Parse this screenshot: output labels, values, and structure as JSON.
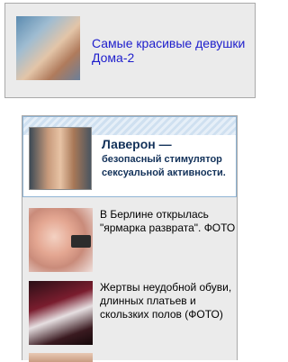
{
  "top_block": {
    "link_text": "Самые красивые девушки Дома-2"
  },
  "featured": {
    "title": "Лаверон —",
    "text": "безопасный стимулятор сексуальной активности."
  },
  "news": [
    {
      "text": "В Берлине открылась \"ярмарка разврата\". ФОТО"
    },
    {
      "text": "Жертвы неудобной обуви, длинных платьев и скользких полов (ФОТО)"
    },
    {
      "text": ""
    }
  ],
  "colors": {
    "link_blue": "#1e1ecc",
    "featured_title": "#13325a",
    "panel_bg": "#ebebeb",
    "panel_border": "#a9a9a9",
    "featured_border": "#8fb4d4"
  }
}
